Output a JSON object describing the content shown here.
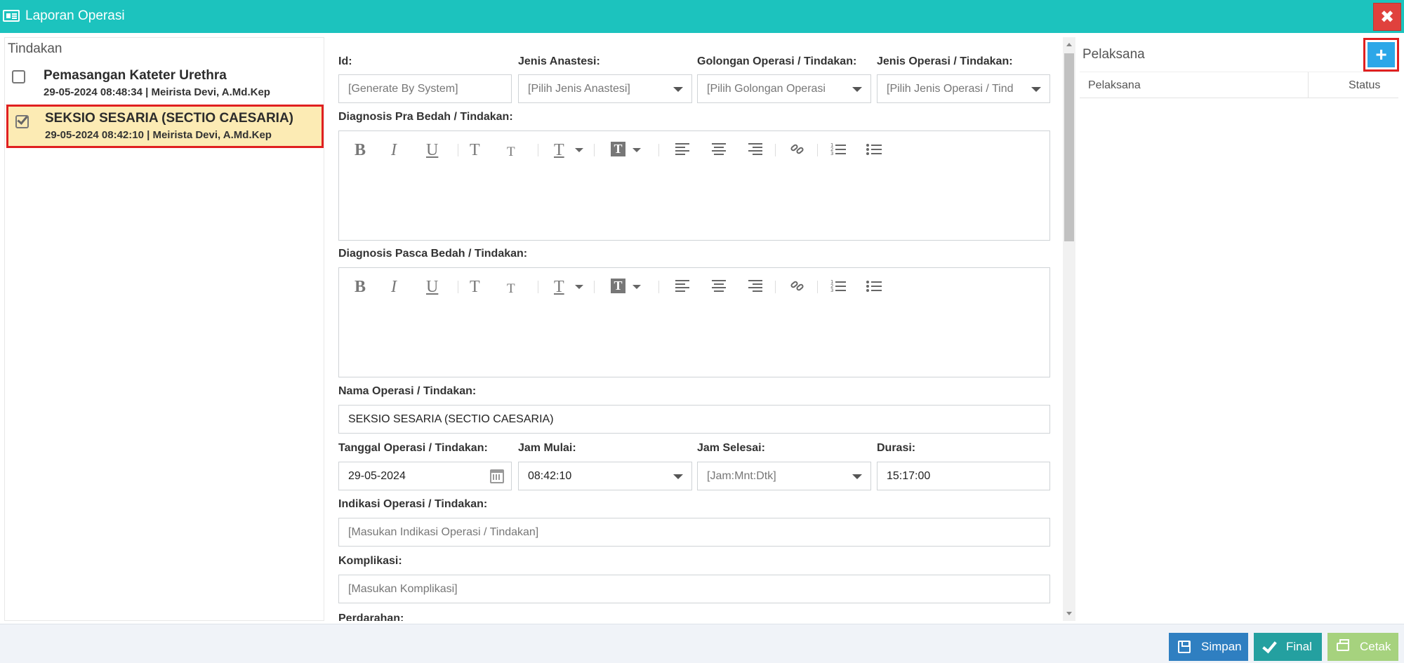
{
  "window": {
    "title": "Laporan Operasi",
    "close_label": "✖"
  },
  "tindakan": {
    "title": "Tindakan",
    "items": [
      {
        "name": "Pemasangan Kateter Urethra",
        "meta": "29-05-2024 08:48:34 | Meirista Devi, A.Md.Kep",
        "checked": false
      },
      {
        "name": "SEKSIO SESARIA (SECTIO CAESARIA)",
        "meta": "29-05-2024 08:42:10 | Meirista Devi, A.Md.Kep",
        "checked": true
      }
    ]
  },
  "form": {
    "id_label": "Id:",
    "id_placeholder": "[Generate By System]",
    "anastesi_label": "Jenis Anastesi:",
    "anastesi_value": "[Pilih Jenis Anastesi]",
    "golongan_label": "Golongan Operasi / Tindakan:",
    "golongan_value": "[Pilih Golongan Operasi",
    "jenis_label": "Jenis Operasi / Tindakan:",
    "jenis_value": "[Pilih Jenis Operasi / Tindakan]",
    "pra_label": "Diagnosis Pra Bedah / Tindakan:",
    "pasca_label": "Diagnosis Pasca Bedah / Tindakan:",
    "nama_label": "Nama Operasi / Tindakan:",
    "nama_value": "SEKSIO SESARIA (SECTIO CAESARIA)",
    "tanggal_label": "Tanggal Operasi / Tindakan:",
    "tanggal_value": "29-05-2024",
    "mulai_label": "Jam Mulai:",
    "mulai_value": "08:42:10",
    "selesai_label": "Jam Selesai:",
    "selesai_value": "[Jam:Mnt:Dtk]",
    "durasi_label": "Durasi:",
    "durasi_value": "15:17:00",
    "indikasi_label": "Indikasi Operasi / Tindakan:",
    "indikasi_placeholder": "[Masukan Indikasi Operasi / Tindakan]",
    "komplikasi_label": "Komplikasi:",
    "komplikasi_placeholder": "[Masukan Komplikasi]",
    "perdarahan_label": "Perdarahan:"
  },
  "editor_toolbar": {
    "bold": "B",
    "italic": "I",
    "underline": "U",
    "font_up": "T",
    "font_down": "T",
    "text_color": "T",
    "bg_color": "T"
  },
  "pelaksana": {
    "title": "Pelaksana",
    "add_label": "+",
    "col_pelaksana": "Pelaksana",
    "col_status": "Status"
  },
  "footer": {
    "simpan": "Simpan",
    "final": "Final",
    "cetak": "Cetak"
  },
  "colors": {
    "titlebar": "#1cc3be",
    "close": "#e0413d",
    "add": "#2ca7e8",
    "simpan": "#2f7fc1",
    "final": "#24a0a0",
    "cetak": "#a6d27e",
    "selected_bg": "#fcebb4",
    "highlight_border": "#e02020"
  }
}
